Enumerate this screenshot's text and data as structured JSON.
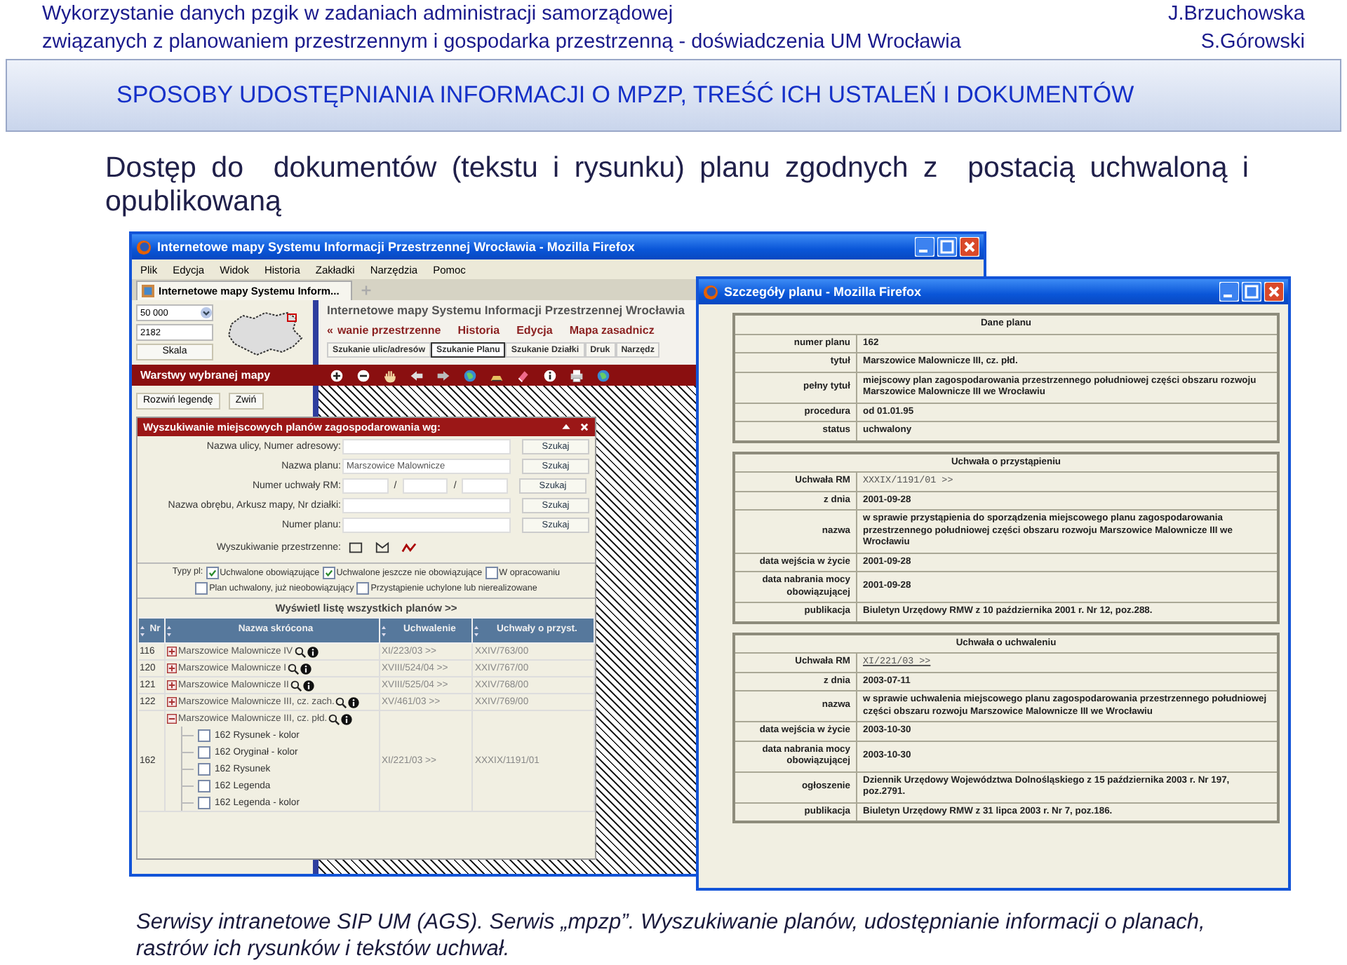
{
  "header": {
    "lines": [
      "Wykorzystanie danych pzgik w zadaniach administracji samorządowej",
      "związanych z planowaniem przestrzennym i gospodarka przestrzenną - doświadczenia UM Wrocławia"
    ],
    "authors": [
      "J.Brzuchowska",
      "S.Górowski"
    ]
  },
  "band_title": "SPOSOBY UDOSTĘPNIANIA INFORMACJI O MPZP, TREŚĆ ICH USTALEŃ I DOKUMENTÓW",
  "heading": "Dostęp do  dokumentów (tekstu i rysunku) planu zgodnych z  postacią uchwaloną i opublikowaną",
  "left_window": {
    "title": "Internetowe mapy Systemu Informacji Przestrzennej Wrocławia - Mozilla Firefox",
    "menu": [
      "Plik",
      "Edycja",
      "Widok",
      "Historia",
      "Zakładki",
      "Narzędzia",
      "Pomoc"
    ],
    "tab": "Internetowe mapy Systemu Inform...",
    "scale_value": "50 000",
    "scale_number": "2182",
    "scale_button": "Skala",
    "app_title": "Internetowe mapy Systemu Informacji Przestrzennej Wrocławia",
    "nav_prev": "«",
    "nav_items": [
      "wanie przestrzenne",
      "Historia",
      "Edycja",
      "Mapa zasadnicz"
    ],
    "subtabs": [
      {
        "label": "Szukanie ulic/adresów",
        "selected": false
      },
      {
        "label": "Szukanie Planu",
        "selected": true
      },
      {
        "label": "Szukanie Działki",
        "selected": false
      },
      {
        "label": "Druk",
        "selected": false
      },
      {
        "label": "Narzędz",
        "selected": false
      }
    ],
    "layers_title": "Warstwy wybranej mapy",
    "expand_button": "Rozwiń legendę",
    "collapse_button": "Zwiń",
    "search_panel": {
      "title": "Wyszukiwanie miejscowych planów zagospodarowania wg:",
      "fields": [
        {
          "kind": "text",
          "label": "Nazwa ulicy, Numer adresowy:",
          "button": "Szukaj"
        },
        {
          "kind": "text",
          "label": "Nazwa planu:",
          "value": "Marszowice Malownicze",
          "button": "Szukaj"
        },
        {
          "kind": "triple",
          "label": "Numer uchwały RM:",
          "separators": [
            "/",
            "/"
          ],
          "button": "Szukaj"
        },
        {
          "kind": "text",
          "label": "Nazwa obrębu, Arkusz mapy, Nr działki:",
          "button": "Szukaj"
        },
        {
          "kind": "text",
          "label": "Numer planu:",
          "button": "Szukaj"
        }
      ],
      "spatial_label": "Wyszukiwanie przestrzenne:",
      "types_label": "Typy pl:",
      "types": [
        {
          "label": "Uchwalone obowiązujące",
          "checked": true
        },
        {
          "label": "Uchwalone jeszcze nie obowiązujące",
          "checked": true
        },
        {
          "label": "W opracowaniu",
          "checked": false
        },
        {
          "label": "Plan uchwalony, już nieobowiązujący",
          "checked": false
        },
        {
          "label": "Przystąpienie uchylone lub nierealizowane",
          "checked": false
        }
      ],
      "list_link": "Wyświetl listę wszystkich planów >>",
      "table": {
        "columns": [
          "Nr",
          "Nazwa skrócona",
          "Uchwalenie",
          "Uchwały o przyst."
        ],
        "rows": [
          {
            "nr": "116",
            "name": "Marszowice Malownicze IV",
            "expanded": false,
            "uchwalenie": "XI/223/03 >>",
            "przyst": "XXIV/763/00"
          },
          {
            "nr": "120",
            "name": "Marszowice Malownicze I",
            "expanded": false,
            "uchwalenie": "XVIII/524/04 >>",
            "przyst": "XXIV/767/00"
          },
          {
            "nr": "121",
            "name": "Marszowice Malownicze II",
            "expanded": false,
            "uchwalenie": "XVIII/525/04 >>",
            "przyst": "XXIV/768/00"
          },
          {
            "nr": "122",
            "name": "Marszowice Malownicze III, cz. zach.",
            "expanded": false,
            "uchwalenie": "XV/461/03 >>",
            "przyst": "XXIV/769/00"
          },
          {
            "nr": "162",
            "name": "Marszowice Malownicze III, cz. płd.",
            "expanded": true,
            "uchwalenie": "XI/221/03 >>",
            "przyst": "XXXIX/1191/01",
            "children": [
              {
                "label": "162 Rysunek - kolor",
                "checked": false
              },
              {
                "label": "162 Oryginał - kolor",
                "checked": false
              },
              {
                "label": "162 Rysunek",
                "checked": false
              },
              {
                "label": "162 Legenda",
                "checked": false
              },
              {
                "label": "162 Legenda - kolor",
                "checked": false
              }
            ]
          }
        ]
      }
    }
  },
  "right_window": {
    "title": "Szczegóły planu - Mozilla Firefox",
    "sections": [
      {
        "title": "Dane planu",
        "rows": [
          {
            "label": "numer planu",
            "value": "162",
            "kind": "text"
          },
          {
            "label": "tytuł",
            "value": "Marszowice Malownicze III, cz. płd.",
            "kind": "text"
          },
          {
            "label": "pełny tytuł",
            "value": "miejscowy plan zagospodarowania przestrzennego południowej części obszaru rozwoju Marszowice Malownicze III we Wrocławiu",
            "kind": "text"
          },
          {
            "label": "procedura",
            "value": "od 01.01.95",
            "kind": "text"
          },
          {
            "label": "status",
            "value": "uchwalony",
            "kind": "text"
          }
        ]
      },
      {
        "title": "Uchwała o przystąpieniu",
        "rows": [
          {
            "label": "Uchwała RM",
            "value": "XXXIX/1191/01 >>",
            "kind": "code"
          },
          {
            "label": "z dnia",
            "value": "2001-09-28",
            "kind": "text"
          },
          {
            "label": "nazwa",
            "value": "w sprawie przystąpienia do sporządzenia miejscowego planu zagospodarowania przestrzennego południowej części obszaru rozwoju Marszowice Malownicze III we Wrocławiu",
            "kind": "text"
          },
          {
            "label": "data wejścia w życie",
            "value": "2001-09-28",
            "kind": "text"
          },
          {
            "label": "data nabrania mocy obowiązującej",
            "value": "2001-09-28",
            "kind": "text"
          },
          {
            "label": "publikacja",
            "value": "Biuletyn Urzędowy RMW z 10 października 2001 r. Nr 12, poz.288.",
            "kind": "text"
          }
        ]
      },
      {
        "title": "Uchwała o uchwaleniu",
        "rows": [
          {
            "label": "Uchwała RM",
            "value": "XI/221/03 >>",
            "kind": "link"
          },
          {
            "label": "z dnia",
            "value": "2003-07-11",
            "kind": "text"
          },
          {
            "label": "nazwa",
            "value": "w sprawie uchwalenia miejscowego planu zagospodarowania przestrzennego południowej części obszaru rozwoju Marszowice Malownicze III we Wrocławiu",
            "kind": "text"
          },
          {
            "label": "data wejścia w życie",
            "value": "2003-10-30",
            "kind": "text"
          },
          {
            "label": "data nabrania mocy obowiązującej",
            "value": "2003-10-30",
            "kind": "text"
          },
          {
            "label": "ogłoszenie",
            "value": "Dziennik Urzędowy Województwa Dolnośląskiego z 15 października 2003 r. Nr 197, poz.2791.",
            "kind": "text"
          },
          {
            "label": "publikacja",
            "value": "Biuletyn Urzędowy RMW z 31 lipca 2003 r. Nr 7, poz.186.",
            "kind": "text"
          }
        ]
      }
    ]
  },
  "caption": "Serwisy intranetowe SIP UM (AGS). Serwis „mpzp”. Wyszukiwanie planów, udostępnianie informacji o planach, rastrów ich rysunków i tekstów uchwał."
}
